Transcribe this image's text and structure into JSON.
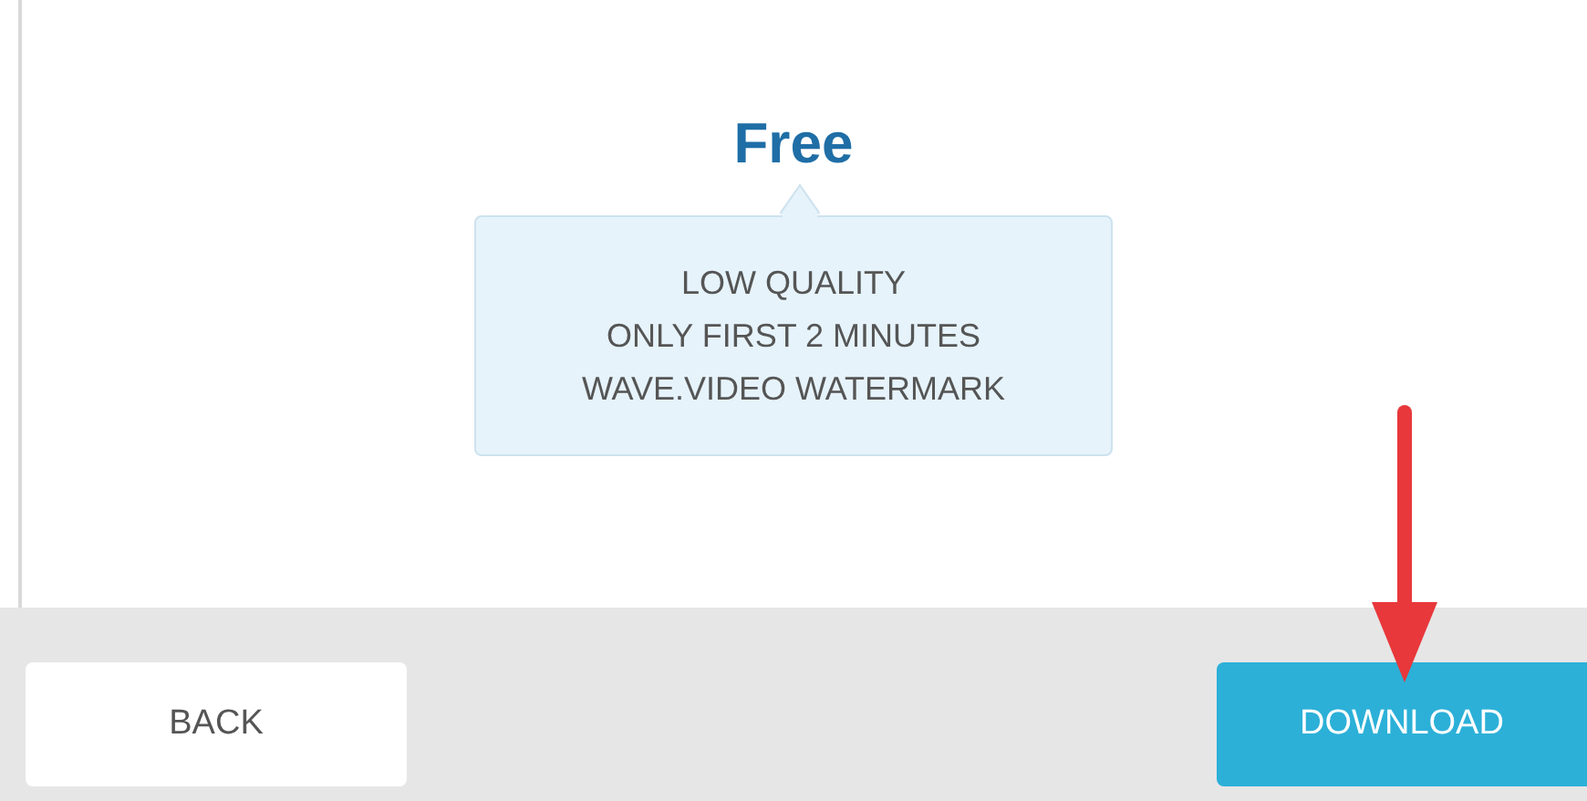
{
  "plan": {
    "title": "Free",
    "features": [
      "LOW QUALITY",
      "ONLY FIRST 2 MINUTES",
      "WAVE.VIDEO WATERMARK"
    ]
  },
  "footer": {
    "buttons": [
      {
        "label": "BACK",
        "kind": "secondary"
      },
      {
        "label": "DOWNLOAD",
        "kind": "primary"
      }
    ]
  }
}
